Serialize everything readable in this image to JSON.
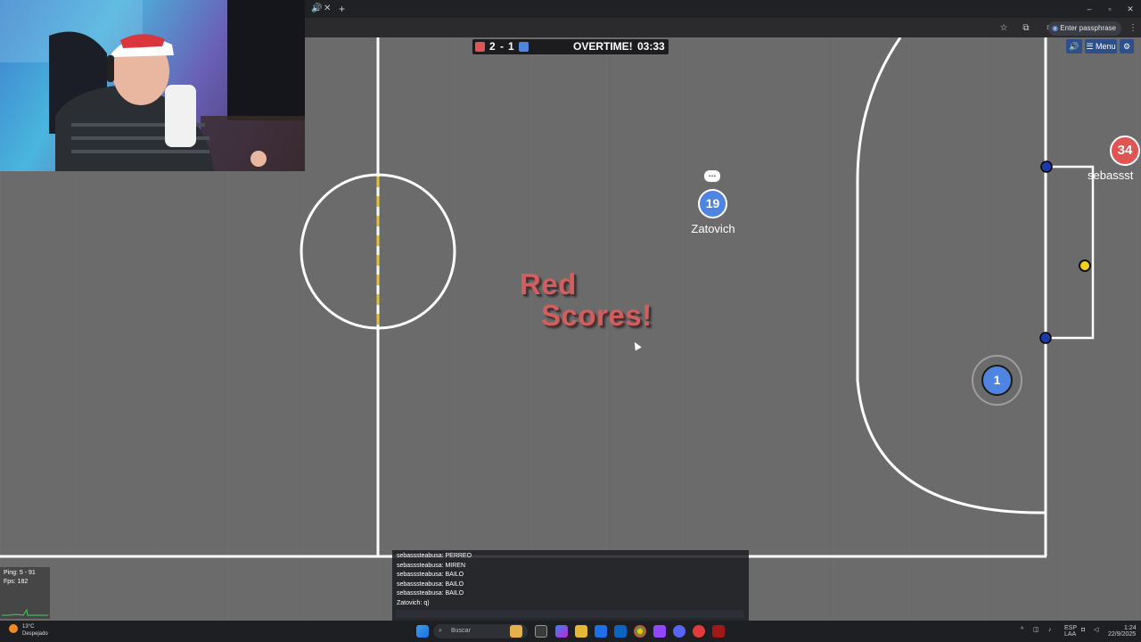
{
  "browser": {
    "tab_icons": [
      "speaker-icon",
      "close-icon"
    ],
    "new_tab": "+",
    "window_controls": {
      "minimize": "–",
      "maximize": "▫",
      "close": "✕"
    },
    "passphrase_label": "Enter passphrase",
    "toolbar_icons": [
      "star-icon",
      "extension-icon",
      "queue-icon"
    ]
  },
  "scoreboard": {
    "red_score": "2",
    "separator": "-",
    "blue_score": "1",
    "status": "OVERTIME!",
    "time": "03:33",
    "colors": {
      "red": "#e05454",
      "blue": "#4f84e0"
    }
  },
  "menu": {
    "sound_icon": "speaker-icon",
    "menu_label": "Menu",
    "settings_icon": "gear-icon"
  },
  "players": [
    {
      "number": "19",
      "name": "Zatovich",
      "team": "blue",
      "chat_bubble": "…"
    },
    {
      "number": "1",
      "name": "",
      "team": "blue"
    },
    {
      "number": "34",
      "name": "sebassst",
      "team": "red"
    }
  ],
  "goal_message": {
    "line1": "Red",
    "line2": "Scores!"
  },
  "chat": {
    "messages": [
      "sebasssteabusa: PERREO",
      "sebasssteabusa: MIREN",
      "sebasssteabusa: BAILO",
      "sebasssteabusa: BAILO",
      "sebasssteabusa: BAILO",
      "Zatovich: q)"
    ],
    "input_value": ""
  },
  "stats": {
    "ping": "Ping: 5 - 91",
    "fps": "Fps: 182"
  },
  "taskbar": {
    "weather_temp": "13°C",
    "weather_desc": "Despejado",
    "search_placeholder": "Buscar",
    "lang_1": "ESP",
    "lang_2": "LAA",
    "time": "1:24",
    "date": "22/9/2025"
  },
  "colors": {
    "field": "#6b6b6b",
    "red_team": "#e05454",
    "blue_team": "#4f84e0",
    "ball": "#f0d020",
    "post_blue": "#1a3aa8"
  }
}
